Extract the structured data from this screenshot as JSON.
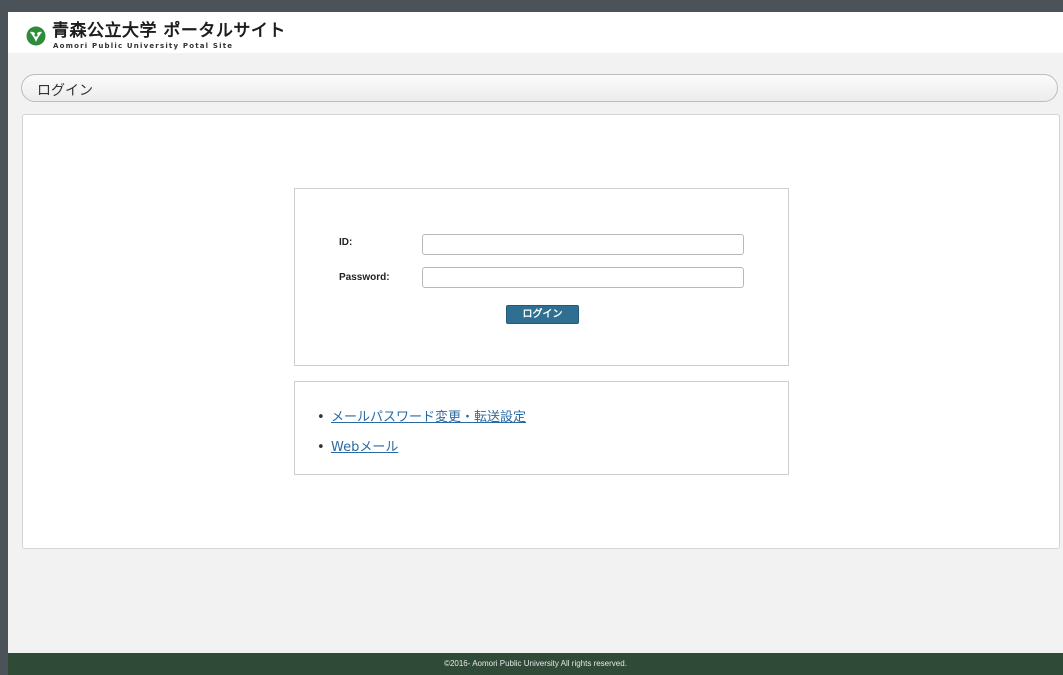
{
  "header": {
    "title": "青森公立大学 ポータルサイト",
    "subtitle": "Aomori Public University Potal Site",
    "logo_icon": "university-logo"
  },
  "breadcrumb": {
    "label": "ログイン"
  },
  "login": {
    "id_label": "ID:",
    "id_value": "",
    "password_label": "Password:",
    "password_value": "",
    "submit_label": "ログイン"
  },
  "links": {
    "items": [
      {
        "label": "メールパスワード変更・転送設定"
      },
      {
        "label": "Webメール"
      }
    ]
  },
  "footer": {
    "copyright": "©2016- Aomori Public University All rights reserved."
  },
  "colors": {
    "footer_bg": "#2f4a36",
    "button_bg": "#2f6f91",
    "link": "#2a6aa3",
    "logo_green": "#2e8b3a"
  }
}
